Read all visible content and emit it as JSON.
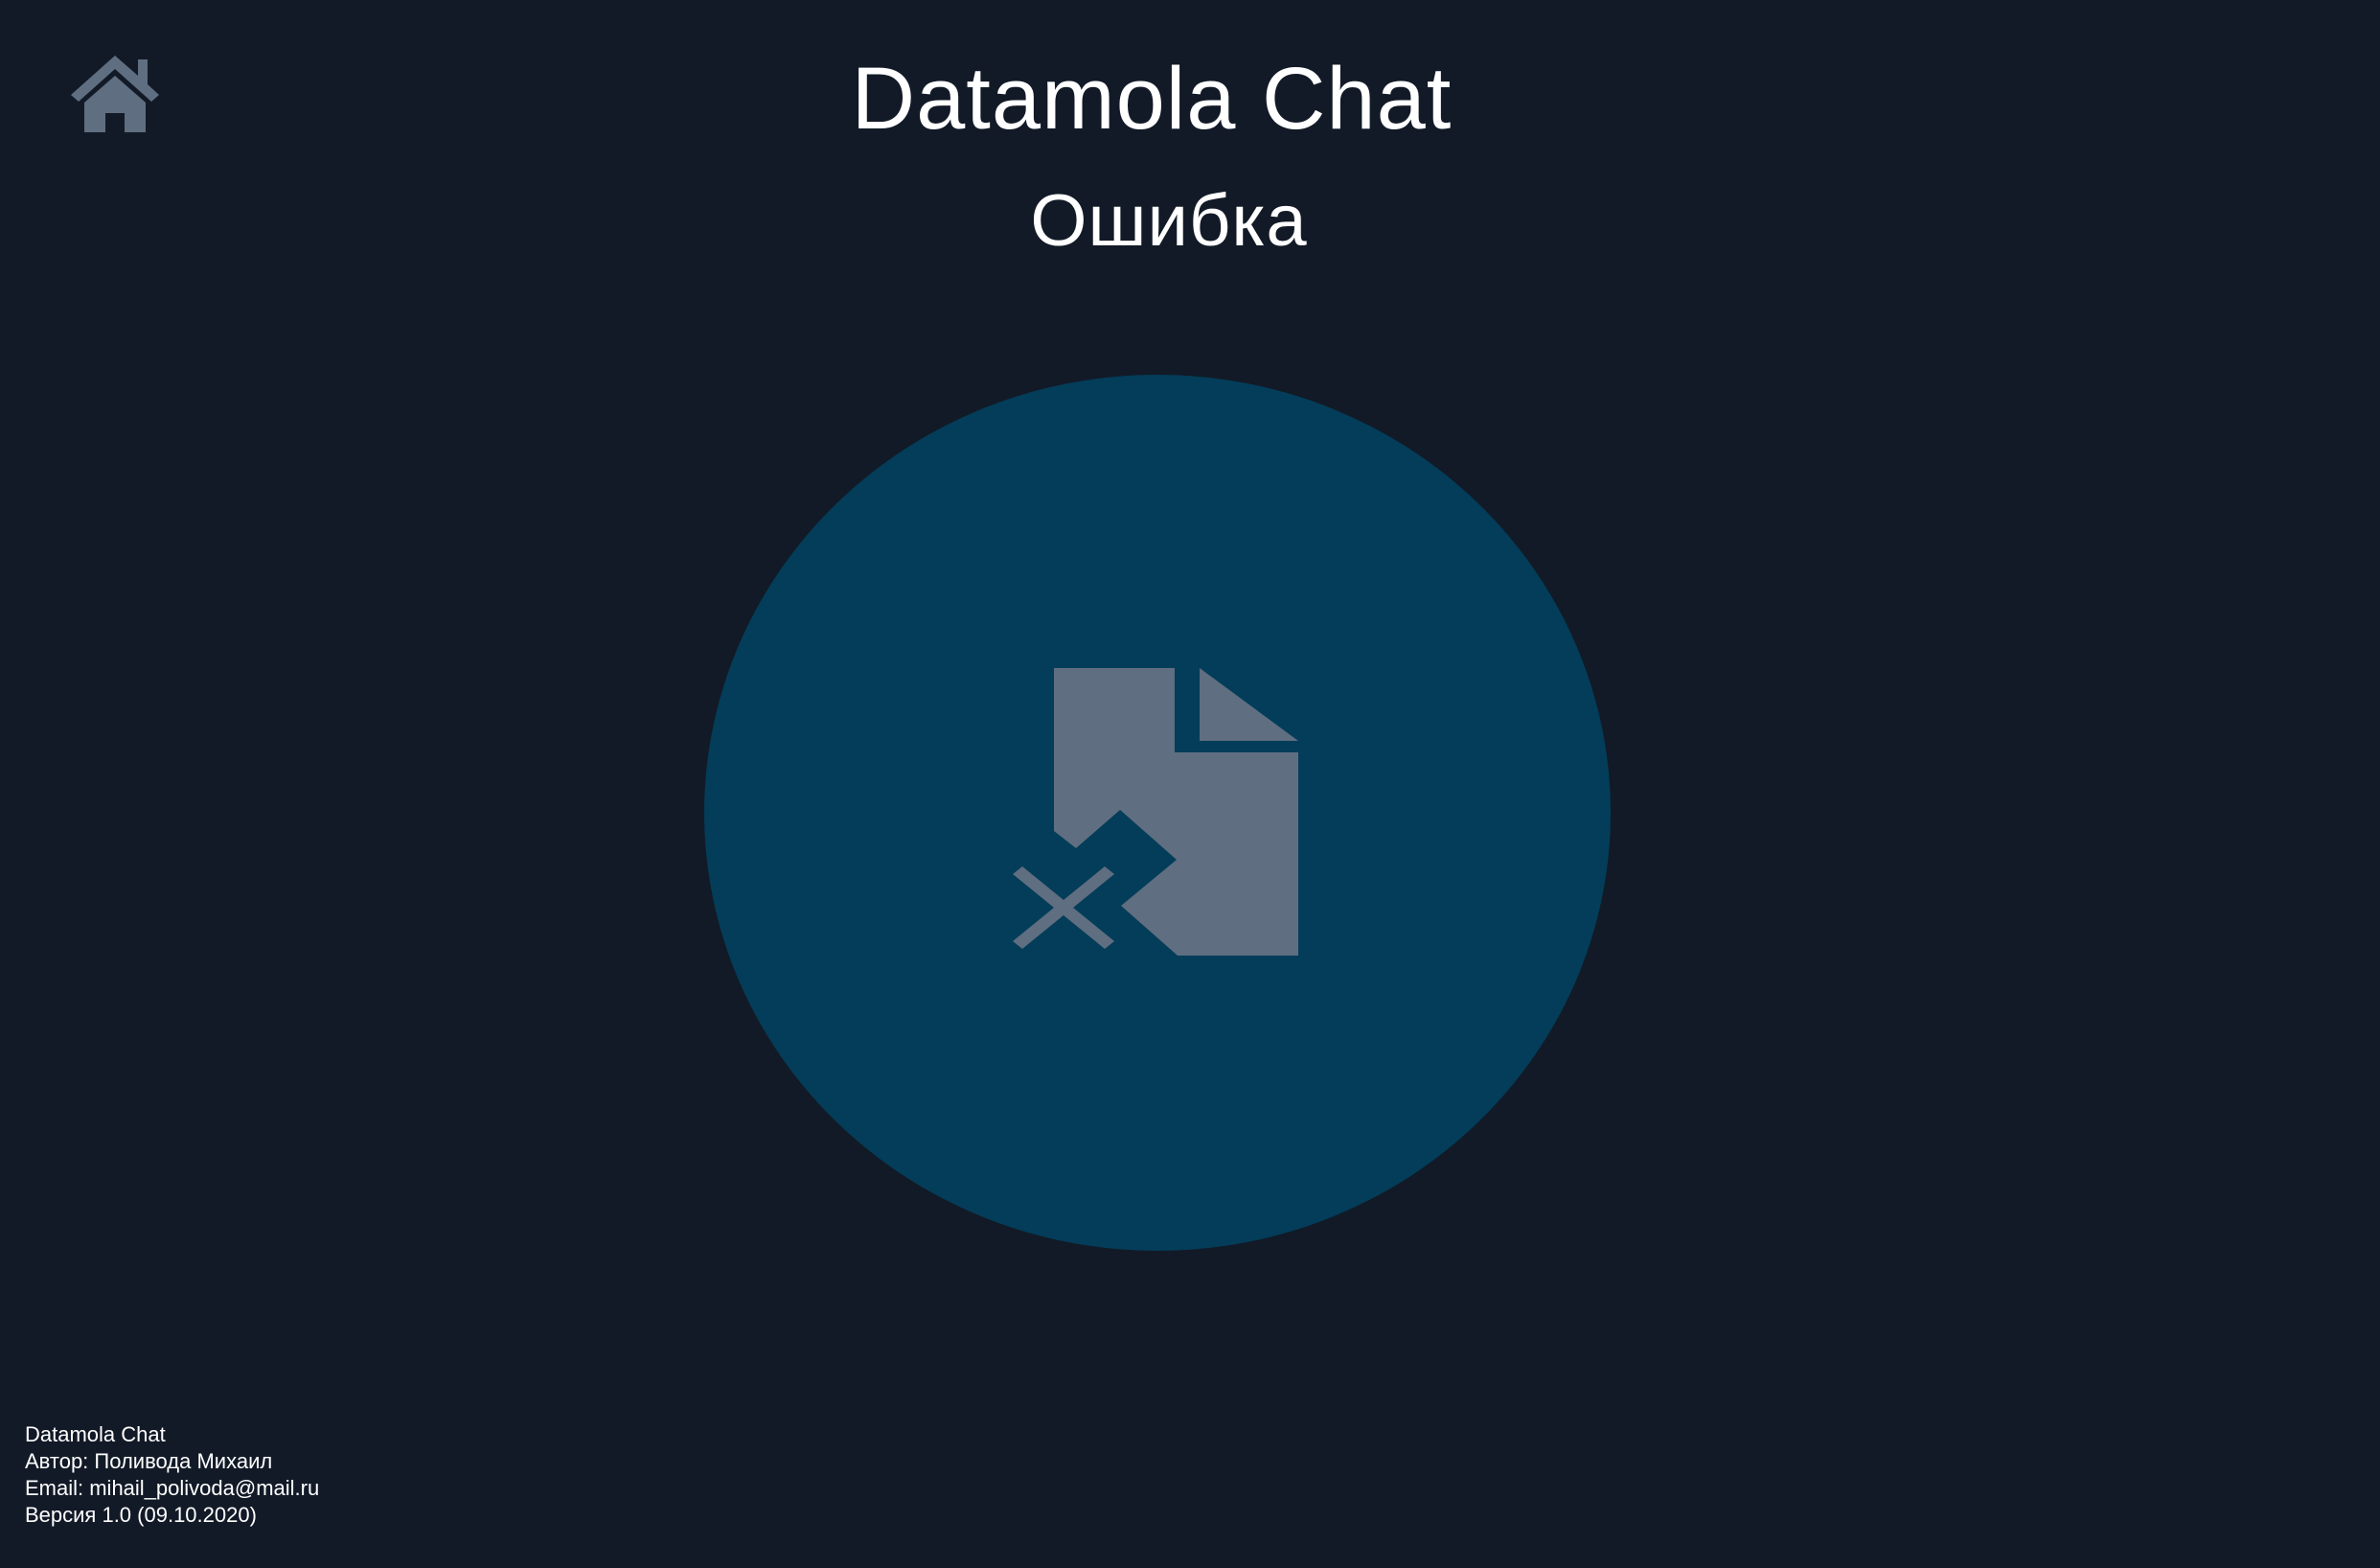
{
  "header": {
    "title": "Datamola Chat",
    "subtitle": "Ошибка"
  },
  "icons": {
    "home": "home-icon",
    "error": "file-error-icon"
  },
  "colors": {
    "background": "#121a27",
    "circle": "#033d59",
    "icon": "#5f6e80",
    "text": "#ffffff"
  },
  "footer": {
    "app_name": "Datamola Chat",
    "author": "Автор: Поливода Михаил",
    "email": "Email: mihail_polivoda@mail.ru",
    "version": "Версия 1.0 (09.10.2020)"
  }
}
